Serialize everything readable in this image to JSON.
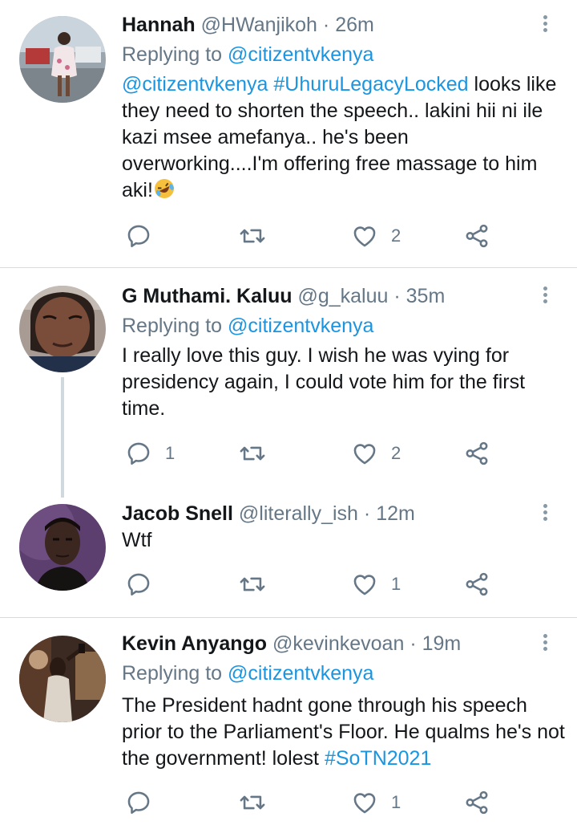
{
  "tweets": [
    {
      "name": "Hannah",
      "handle": "@HWanjikoh",
      "time": "26m",
      "replying_prefix": "Replying to",
      "replying_to": "@citizentvkenya",
      "mention": "@citizentvkenya",
      "hashtag": "#UhuruLegacyLocked",
      "text_main": "looks like they need to shorten the speech.. lakini hii ni ile kazi msee amefanya.. he's been overworking....I'm offering free massage to him aki!",
      "reply_count": "",
      "retweet_count": "",
      "like_count": "2"
    },
    {
      "name": "G Muthami. Kaluu",
      "handle": "@g_kaluu",
      "time": "35m",
      "replying_prefix": "Replying to",
      "replying_to": "@citizentvkenya",
      "text": "I really love this guy. I wish he was vying for presidency again, I could vote him for the first time.",
      "reply_count": "1",
      "retweet_count": "",
      "like_count": "2"
    },
    {
      "name": "Jacob Snell",
      "handle": "@literally_ish",
      "time": "12m",
      "text": "Wtf",
      "reply_count": "",
      "retweet_count": "",
      "like_count": "1"
    },
    {
      "name": "Kevin Anyango",
      "handle": "@kevinkevoan",
      "time": "19m",
      "replying_prefix": "Replying to",
      "replying_to": "@citizentvkenya",
      "text_main": "The President hadnt gone through his speech prior to the Parliament's Floor. He qualms he's not the government! lolest",
      "hashtag": "#SoTN2021",
      "reply_count": "",
      "retweet_count": "",
      "like_count": "1"
    }
  ],
  "separator": "·",
  "colors": {
    "link": "#1b95e0",
    "secondary": "#657786",
    "icon": "#657786",
    "divider": "#d6dbdf"
  },
  "icons": [
    "reply-icon",
    "retweet-icon",
    "like-icon",
    "share-icon",
    "more-icon"
  ]
}
